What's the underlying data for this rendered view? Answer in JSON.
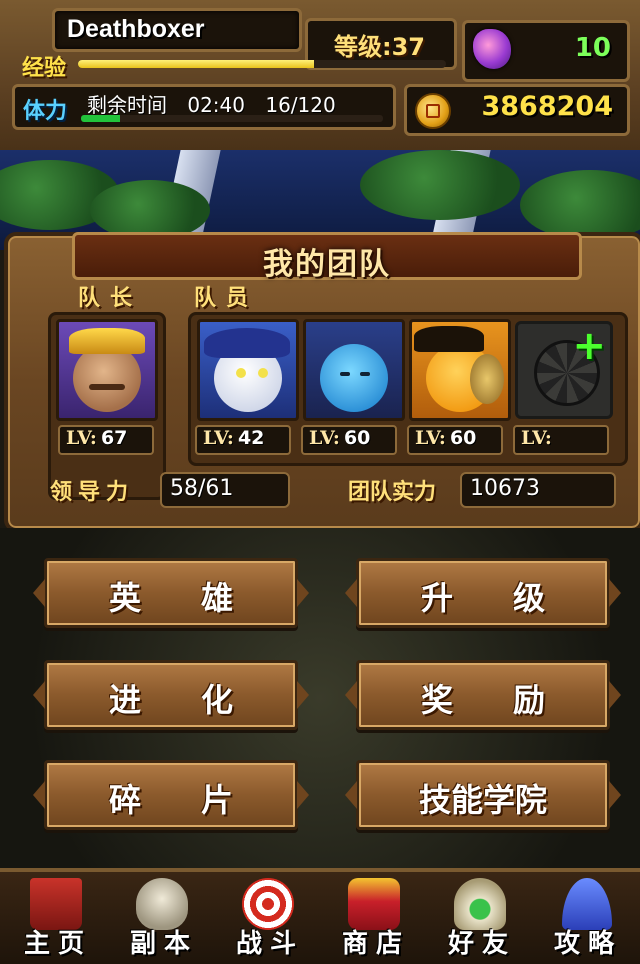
{
  "player": {
    "name": "Deathboxer",
    "level_label": "等级:37",
    "exp_label": "经验",
    "exp_progress": 0.64,
    "stamina_label": "体力",
    "stamina_time_label": "剩余时间",
    "stamina_timer": "02:40",
    "stamina": "16/120",
    "stamina_progress": 0.13,
    "gems": "10",
    "gold": "3868204"
  },
  "team": {
    "title": "我的团队",
    "leader_label": "队长",
    "members_label": "队员",
    "lv_label": "LV:",
    "leader": {
      "level": "67"
    },
    "members": [
      {
        "level": "42"
      },
      {
        "level": "60"
      },
      {
        "level": "60"
      },
      {
        "level": ""
      }
    ],
    "leadership_label": "领导力",
    "leadership_value": "58/61",
    "team_power_label": "团队实力",
    "team_power_value": "10673"
  },
  "menu": {
    "heroes": "英雄",
    "upgrade": "升级",
    "evolve": "进化",
    "rewards": "奖励",
    "fragments": "碎片",
    "skill_academy": "技能学院"
  },
  "nav": [
    {
      "label": "主页",
      "icon": "house-icon"
    },
    {
      "label": "副本",
      "icon": "skull-icon"
    },
    {
      "label": "战斗",
      "icon": "target-icon"
    },
    {
      "label": "商店",
      "icon": "shop-icon"
    },
    {
      "label": "好友",
      "icon": "wings-icon"
    },
    {
      "label": "攻略",
      "icon": "wizard-hat-icon"
    }
  ],
  "colors": {
    "accent_gold": "#ffe24a",
    "gem_green": "#7cff5a",
    "stamina_blue": "#5ad1ff",
    "plus_green": "#4cff2e"
  }
}
